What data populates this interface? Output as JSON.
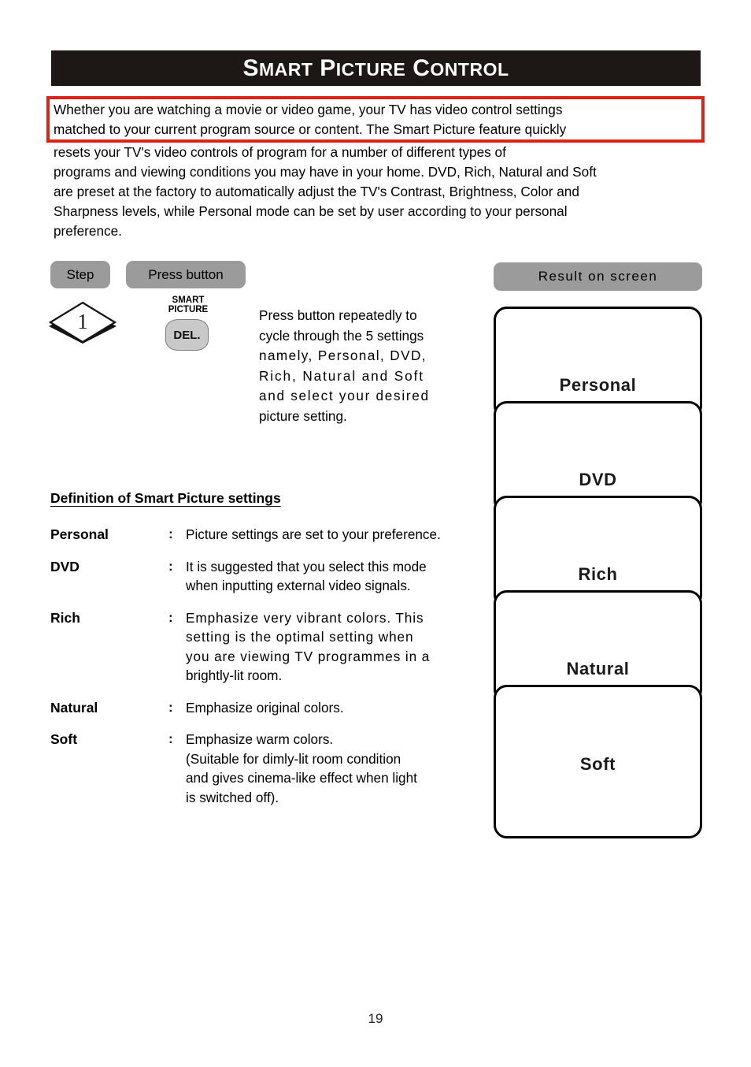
{
  "header": {
    "title_full": "SMART PICTURE CONTROL",
    "title_parts": [
      {
        "cap": "S",
        "rest": "MART"
      },
      {
        "cap": "P",
        "rest": "ICTURE"
      },
      {
        "cap": "C",
        "rest": "ONTROL"
      }
    ]
  },
  "intro": {
    "highlighted_lines": [
      "Whether you are watching a movie or video game, your TV has  video control settings",
      "matched to your current program source or content. The Smart Picture feature quickly"
    ],
    "remaining_lines": [
      "resets your TV's video controls of program for a number of different types of",
      "programs and viewing conditions you may have in your home. DVD, Rich, Natural and Soft",
      "are preset at the factory to automatically adjust the TV's Contrast, Brightness, Color and",
      "Sharpness levels, while Personal mode can be set by user according to your personal",
      "preference."
    ],
    "highlight_color": "#dd2216"
  },
  "columns": {
    "step_label": "Step",
    "press_label": "Press  button",
    "result_label": "Result  on  screen"
  },
  "step": {
    "number": "1",
    "button_name_line1": "SMART",
    "button_name_line2": "PICTURE",
    "button_key": "DEL.",
    "instruction_lines": [
      "Press button repeatedly to",
      "cycle through the 5 settings",
      "namely, Personal, DVD,",
      "Rich, Natural and Soft",
      "and select your desired",
      "picture setting."
    ]
  },
  "definitions": {
    "heading": "Definition of Smart Picture settings",
    "separator": ":",
    "items": [
      {
        "term": "Personal",
        "lines": [
          "Picture settings are set to your preference."
        ]
      },
      {
        "term": "DVD",
        "lines": [
          "It is suggested that you select this mode",
          "when inputting external video signals."
        ]
      },
      {
        "term": "Rich",
        "lines": [
          "Emphasize very vibrant colors. This",
          "setting is the optimal setting when",
          "you are viewing TV programmes in a",
          "brightly-lit room."
        ]
      },
      {
        "term": "Natural",
        "lines": [
          "Emphasize original colors."
        ]
      },
      {
        "term": "Soft",
        "lines": [
          "Emphasize  warm colors.",
          "(Suitable for dimly-lit room condition",
          "and gives cinema-like effect when light",
          "is switched off)."
        ]
      }
    ]
  },
  "screens": {
    "boxes": [
      {
        "label": "Personal"
      },
      {
        "label": "DVD"
      },
      {
        "label": "Rich"
      },
      {
        "label": "Natural"
      },
      {
        "label": "Soft"
      }
    ]
  },
  "footer": {
    "page_number": "19"
  }
}
